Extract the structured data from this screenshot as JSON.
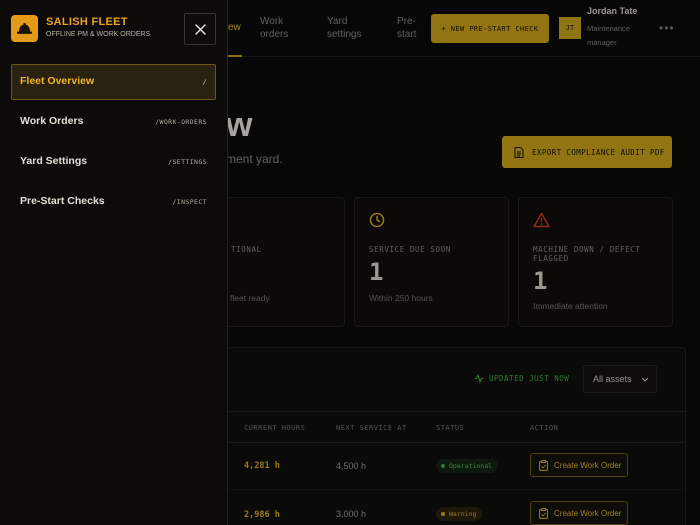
{
  "header": {
    "nav": [
      {
        "label": "Work orders"
      },
      {
        "label": "Yard settings"
      },
      {
        "label": "Pre-start"
      }
    ],
    "active_nav_fragment": "ew",
    "new_check_label": "+ NEW PRE-START CHECK",
    "user": {
      "initials": "JT",
      "name": "Jordan Tate",
      "role": "Maintenance manager"
    }
  },
  "main": {
    "title_fragment": "w",
    "subtitle_fragment": "ment yard.",
    "export_label": "EXPORT COMPLIANCE AUDIT PDF",
    "stats": [
      {
        "label": "TIONAL",
        "value": "",
        "hint": "fleet ready"
      },
      {
        "label": "SERVICE DUE SOON",
        "value": "1",
        "hint": "Within 250 hours"
      },
      {
        "label": "MACHINE DOWN / DEFECT FLAGGED",
        "value": "1",
        "hint": "Immediate attention"
      }
    ],
    "updated_label": "UPDATED JUST NOW",
    "asset_filter": "All assets",
    "table": {
      "columns": [
        "CURRENT HOURS",
        "NEXT SERVICE AT",
        "STATUS",
        "ACTION"
      ],
      "rows": [
        {
          "hours": "4,281 h",
          "next": "4,500 h",
          "status": "Operational",
          "action": "Create Work Order"
        },
        {
          "hours": "2,986 h",
          "next": "3,000 h",
          "status": "Warning",
          "action": "Create Work Order"
        }
      ]
    },
    "colors": {
      "accent": "#c9a21a",
      "operational": "#43a44e",
      "warning": "#d9a820",
      "danger": "#c0392b"
    }
  },
  "drawer": {
    "brand": "SALISH FLEET",
    "subtitle": "OFFLINE PM & WORK ORDERS",
    "menu": [
      {
        "label": "Fleet Overview",
        "path": "/"
      },
      {
        "label": "Work Orders",
        "path": "/WORK-ORDERS"
      },
      {
        "label": "Yard Settings",
        "path": "/SETTINGS"
      },
      {
        "label": "Pre-Start Checks",
        "path": "/INSPECT"
      }
    ]
  }
}
